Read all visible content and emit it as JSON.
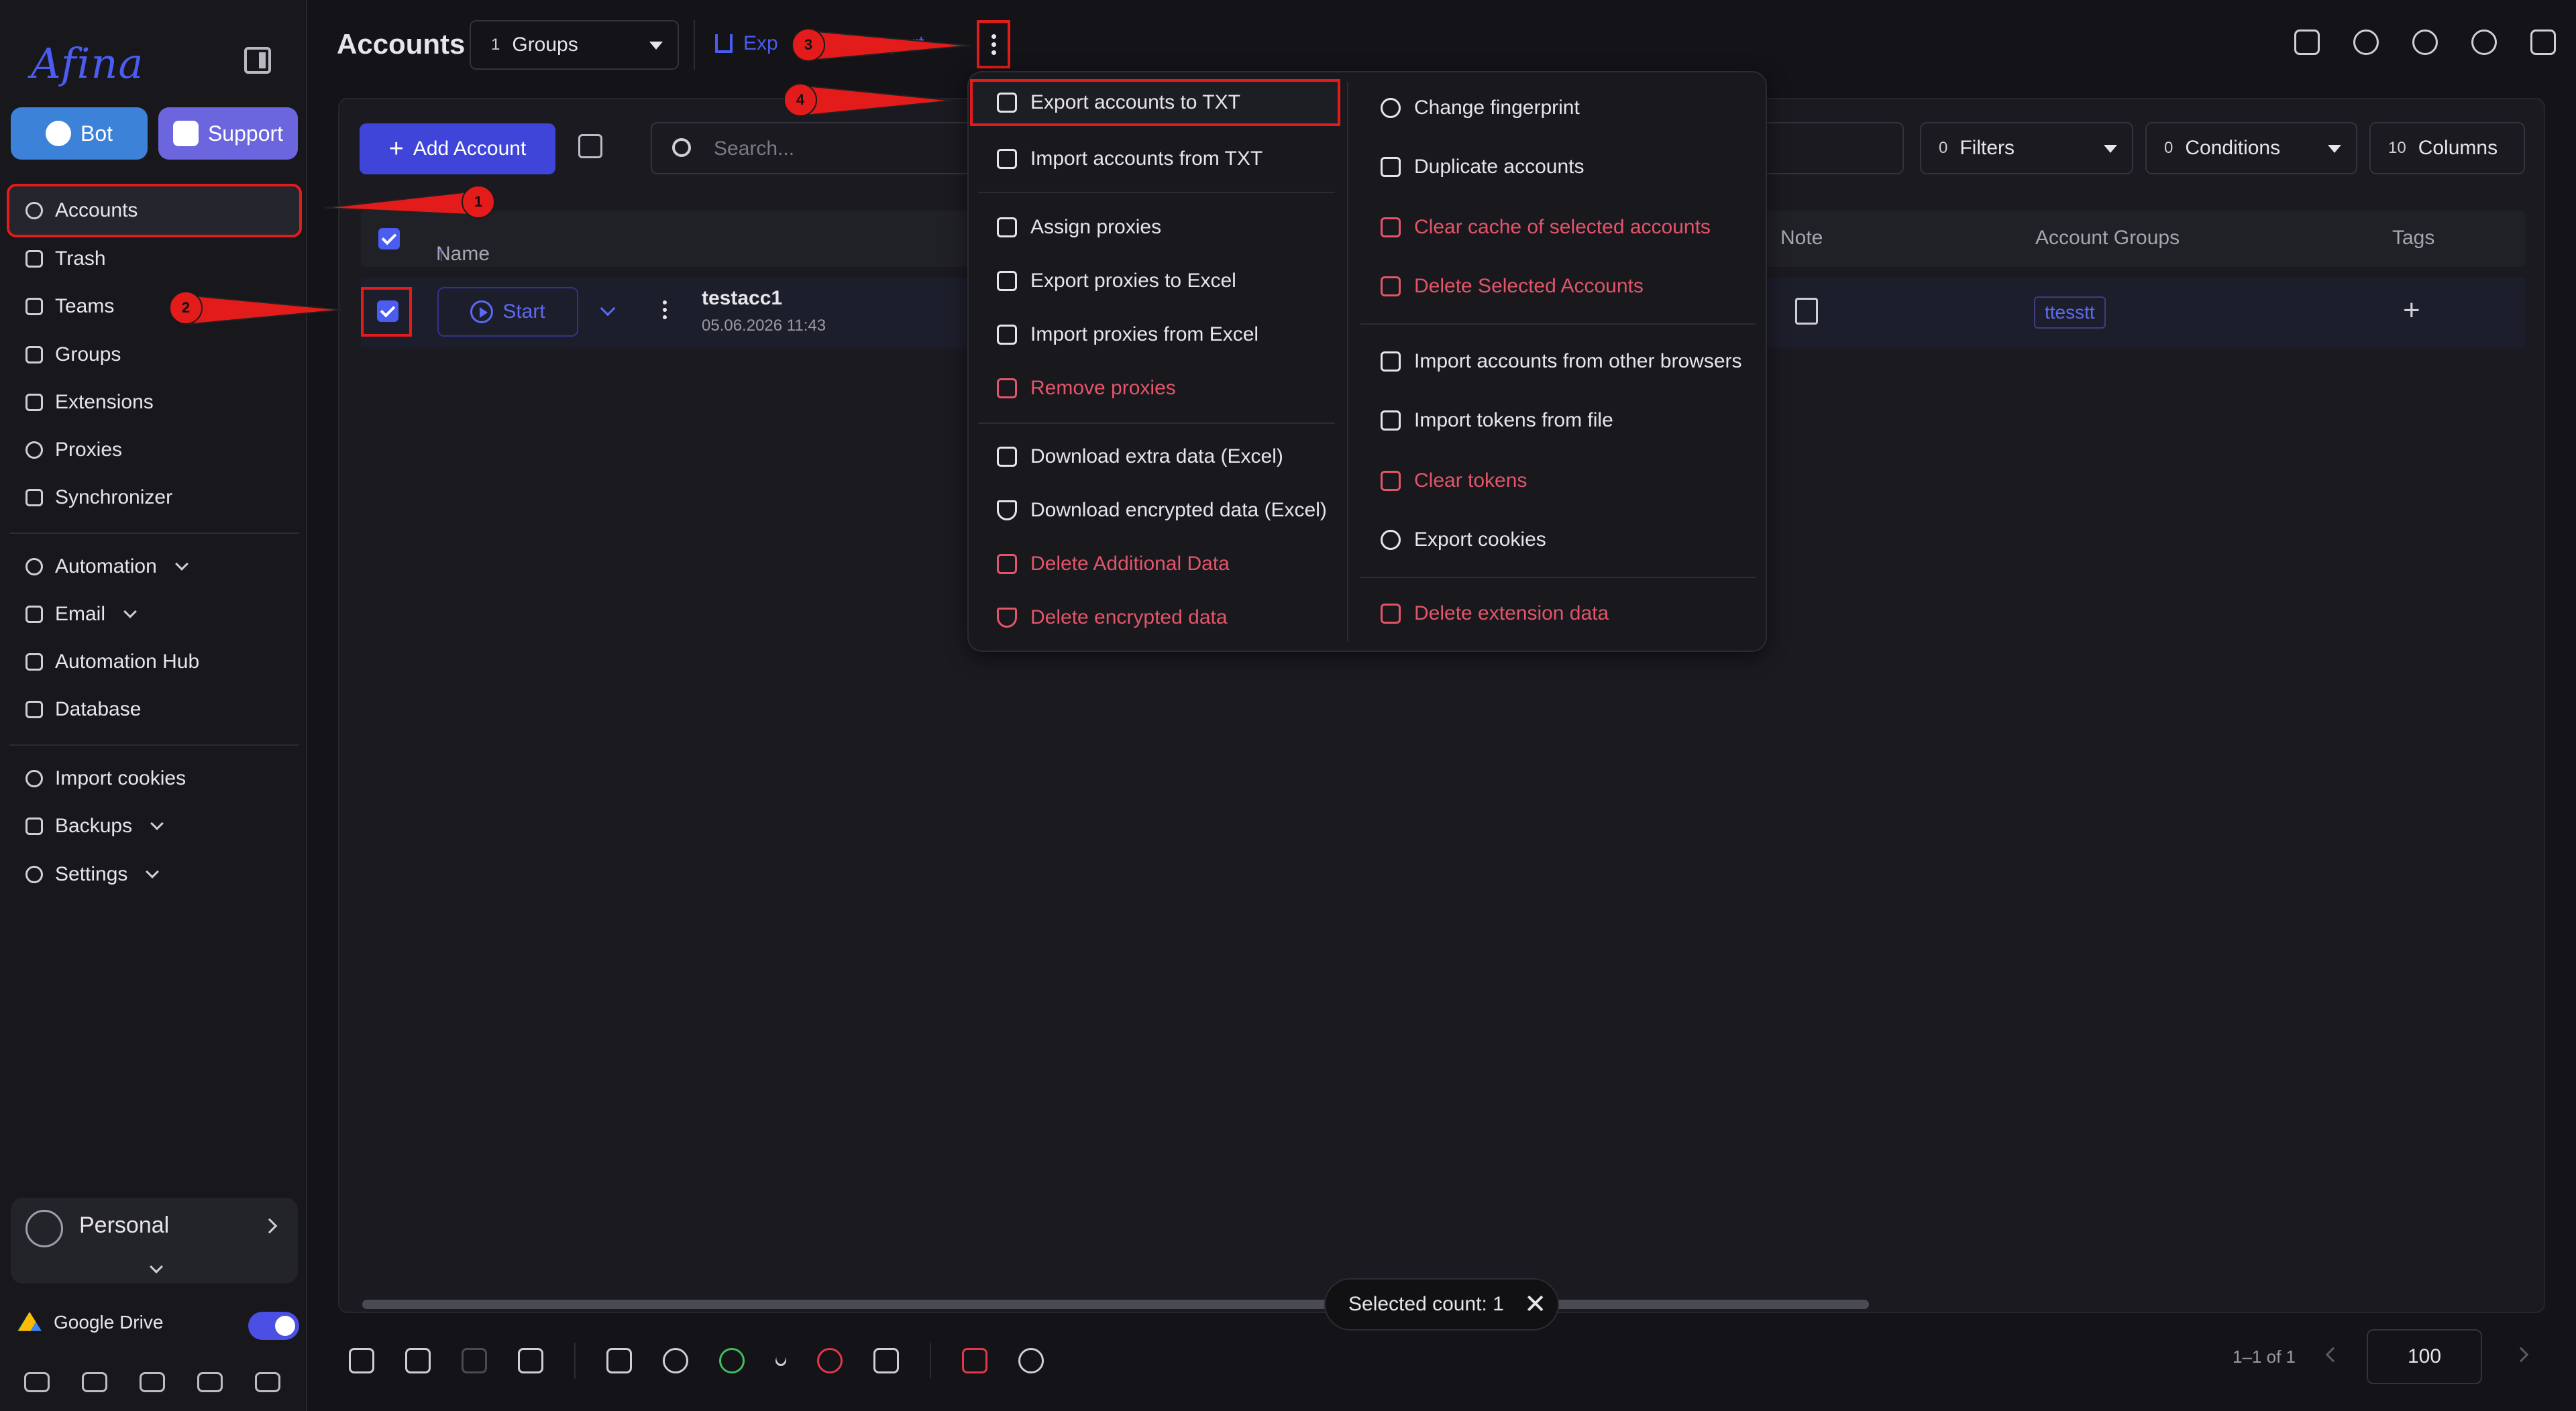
{
  "colors": {
    "accent": "#4b5cf0",
    "danger": "#e3556a",
    "annotation": "#e31b1b",
    "background": "#131318"
  },
  "sidebar": {
    "logo": "Afina",
    "bot_label": "Bot",
    "support_label": "Support",
    "items": [
      {
        "label": "Accounts",
        "icon": "account-circle-icon"
      },
      {
        "label": "Trash",
        "icon": "trash-icon"
      },
      {
        "label": "Teams",
        "icon": "teams-icon"
      },
      {
        "label": "Groups",
        "icon": "groups-icon"
      },
      {
        "label": "Extensions",
        "icon": "puzzle-icon"
      },
      {
        "label": "Proxies",
        "icon": "cloud-icon"
      },
      {
        "label": "Synchronizer",
        "icon": "sync-icon"
      },
      {
        "label": "Automation",
        "icon": "automation-icon"
      },
      {
        "label": "Email",
        "icon": "mail-icon"
      },
      {
        "label": "Automation Hub",
        "icon": "laptop-icon"
      },
      {
        "label": "Database",
        "icon": "list-icon"
      },
      {
        "label": "Import cookies",
        "icon": "cookie-icon"
      },
      {
        "label": "Backups",
        "icon": "backup-icon"
      },
      {
        "label": "Settings",
        "icon": "gear-icon"
      }
    ],
    "profile_name": "Personal",
    "gdrive_label": "Google Drive"
  },
  "header": {
    "title": "Accounts",
    "groups_count": "1",
    "groups_label": "Groups",
    "export_label": "Exp",
    "import_label": "port"
  },
  "toolbar": {
    "add_account_label": "Add Account",
    "search_placeholder": "Search...",
    "filters_count": "0",
    "filters_label": "Filters",
    "conditions_count": "0",
    "conditions_label": "Conditions",
    "columns_count": "10",
    "columns_label": "Columns"
  },
  "table": {
    "headers": {
      "name": "Name",
      "note": "Note",
      "groups": "Account Groups",
      "tags": "Tags"
    },
    "rows": [
      {
        "start_label": "Start",
        "name": "testacc1",
        "date": "05.06.2026 11:43",
        "group": "ttesstt"
      }
    ]
  },
  "menu": {
    "left": [
      {
        "label": "Export accounts to TXT",
        "icon": "export-icon",
        "danger": false
      },
      {
        "label": "Import accounts from TXT",
        "icon": "import-icon",
        "danger": false
      },
      {
        "label": "Assign proxies",
        "icon": "link-icon",
        "danger": false
      },
      {
        "label": "Export proxies to Excel",
        "icon": "excel-export-icon",
        "danger": false
      },
      {
        "label": "Import proxies from Excel",
        "icon": "download-icon",
        "danger": false
      },
      {
        "label": "Remove proxies",
        "icon": "link-off-icon",
        "danger": true
      },
      {
        "label": "Download extra data (Excel)",
        "icon": "download-icon",
        "danger": false
      },
      {
        "label": "Download encrypted data (Excel)",
        "icon": "shield-icon",
        "danger": false
      },
      {
        "label": "Delete Additional Data",
        "icon": "trash-icon",
        "danger": true
      },
      {
        "label": "Delete encrypted data",
        "icon": "shield-off-icon",
        "danger": true
      }
    ],
    "right": [
      {
        "label": "Change fingerprint",
        "icon": "fingerprint-icon",
        "danger": false
      },
      {
        "label": "Duplicate accounts",
        "icon": "copy-icon",
        "danger": false
      },
      {
        "label": "Clear cache of selected accounts",
        "icon": "broom-icon",
        "danger": true
      },
      {
        "label": "Delete Selected Accounts",
        "icon": "user-remove-icon",
        "danger": true
      },
      {
        "label": "Import accounts from other browsers",
        "icon": "swap-icon",
        "danger": false
      },
      {
        "label": "Import tokens from file",
        "icon": "key-icon",
        "danger": false
      },
      {
        "label": "Clear tokens",
        "icon": "key-off-icon",
        "danger": true
      },
      {
        "label": "Export cookies",
        "icon": "cookie-icon",
        "danger": false
      },
      {
        "label": "Delete extension data",
        "icon": "puzzle-off-icon",
        "danger": true
      }
    ]
  },
  "status": {
    "selected_count": "Selected count: 1"
  },
  "pagination": {
    "info": "1–1 of 1",
    "page_size": "100"
  },
  "annotations": [
    "1",
    "2",
    "3",
    "4"
  ]
}
